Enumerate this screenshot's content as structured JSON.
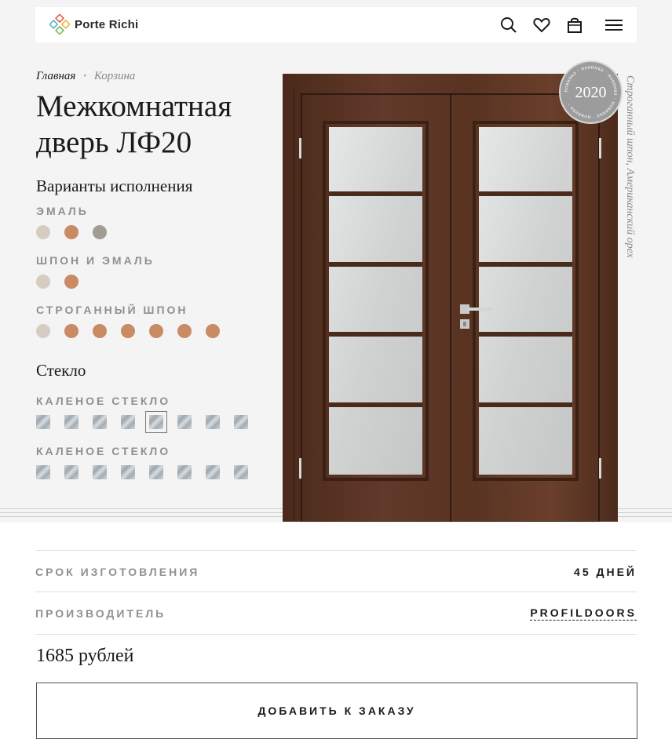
{
  "header": {
    "logo_text": "Porte Richi",
    "icons": [
      "search-icon",
      "heart-icon",
      "bag-icon",
      "menu-icon"
    ]
  },
  "breadcrumb": {
    "home": "Главная",
    "current": "Корзина"
  },
  "product": {
    "title": "Межкомнатная дверь ЛФ20",
    "badge_text": "новинка",
    "badge_year": "2020",
    "caption": "Строганный шпон, Американский орех"
  },
  "variants": {
    "title": "Варианты исполнения",
    "groups": [
      {
        "label": "ЭМАЛЬ",
        "colors": [
          "#d6ccc1",
          "#c98a64",
          "#a29c92"
        ]
      },
      {
        "label": "ШПОН И ЭМАЛЬ",
        "colors": [
          "#d6ccc1",
          "#c98a64"
        ]
      },
      {
        "label": "СТРОГАННЫЙ ШПОН",
        "colors": [
          "#d6ccc1",
          "#c98a64",
          "#c98a64",
          "#c98a64",
          "#c98a64",
          "#c98a64",
          "#c98a64"
        ]
      }
    ]
  },
  "glass": {
    "title": "Стекло",
    "groups": [
      {
        "label": "КАЛЕНОЕ СТЕКЛО",
        "count": 8,
        "selected_index": 4
      },
      {
        "label": "КАЛЕНОЕ СТЕКЛО",
        "count": 8,
        "selected_index": -1
      }
    ]
  },
  "info": {
    "lead_time_label": "СРОК ИЗГОТОВЛЕНИЯ",
    "lead_time_value": "45 ДНЕЙ",
    "manufacturer_label": "ПРОИЗВОДИТЕЛЬ",
    "manufacturer_value": "PROFILDOORS"
  },
  "price": "1685 рублей",
  "add_button_label": "ДОБАВИТЬ К ЗАКАЗУ",
  "colors": {
    "door_wood": "#5a3422",
    "glass": "#d9dcdc",
    "badge": "#9c9c9c"
  }
}
